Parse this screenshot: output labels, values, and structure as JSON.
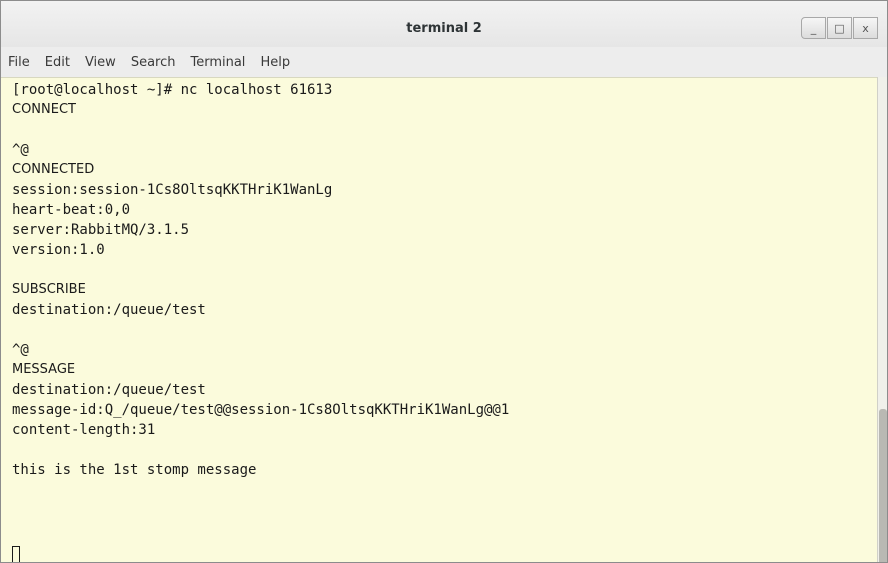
{
  "window": {
    "title": "terminal 2",
    "minimize_glyph": "_",
    "maximize_glyph": "□",
    "close_glyph": "x"
  },
  "menu": [
    "File",
    "Edit",
    "View",
    "Search",
    "Terminal",
    "Help"
  ],
  "terminal": {
    "lines": [
      {
        "text": "[root@localhost ~]# nc localhost 61613",
        "style": "mono"
      },
      {
        "text": "CONNECT",
        "style": "sans"
      },
      {
        "text": "",
        "style": "mono"
      },
      {
        "text": "^@",
        "style": "mono"
      },
      {
        "text": "CONNECTED",
        "style": "sans"
      },
      {
        "text": "session:session-1Cs8OltsqKKTHriK1WanLg",
        "style": "mono"
      },
      {
        "text": "heart-beat:0,0",
        "style": "mono"
      },
      {
        "text": "server:RabbitMQ/3.1.5",
        "style": "mono"
      },
      {
        "text": "version:1.0",
        "style": "mono"
      },
      {
        "text": "",
        "style": "mono"
      },
      {
        "text": "SUBSCRIBE",
        "style": "sans"
      },
      {
        "text": "destination:/queue/test",
        "style": "mono"
      },
      {
        "text": "",
        "style": "mono"
      },
      {
        "text": "^@",
        "style": "mono"
      },
      {
        "text": "MESSAGE",
        "style": "sans"
      },
      {
        "text": "destination:/queue/test",
        "style": "mono"
      },
      {
        "text": "message-id:Q_/queue/test@@session-1Cs8OltsqKKTHriK1WanLg@@1",
        "style": "mono"
      },
      {
        "text": "content-length:31",
        "style": "mono"
      },
      {
        "text": "",
        "style": "mono"
      },
      {
        "text": "this is the 1st stomp message",
        "style": "mono"
      }
    ]
  }
}
